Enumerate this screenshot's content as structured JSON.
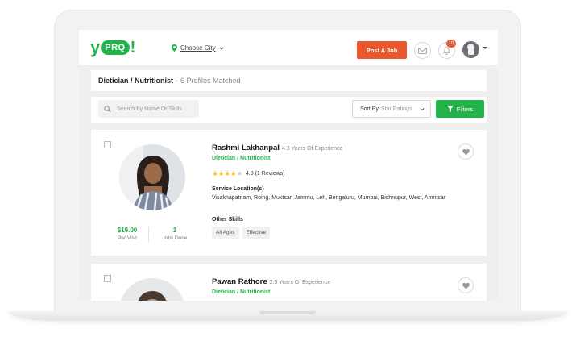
{
  "header": {
    "logo": {
      "y": "y",
      "prq": "PRQ",
      "ex": "!"
    },
    "city_label": "Choose City",
    "post_job_label": "Post A Job",
    "notifications_count": "10",
    "icons": [
      "location-pin-icon",
      "chevron-down-icon",
      "mail-icon",
      "bell-icon",
      "user-avatar",
      "caret-down-icon"
    ]
  },
  "results": {
    "query": "Dietician / Nutritionist",
    "separator": "-",
    "count_text": "6 Profiles Matched"
  },
  "filters": {
    "search_placeholder": "Search By Name Or Skills",
    "sort_label": "Sort By",
    "sort_value": "Star Ratings",
    "filters_label": "Filters"
  },
  "profiles": [
    {
      "name": "Rashmi Lakhanpal",
      "experience": "4.3 Years Of Experience",
      "role": "Dietician / Nutritionist",
      "rating_stars": 4,
      "rating_text": "4.0 (1 Reviews)",
      "service_location_label": "Service Location(s)",
      "service_locations": "Visakhapatnam, Roing, Muktsar, Jammu, Leh, Bengaluru, Mumbai, Bishnupur, West, Amritsar",
      "other_skills_label": "Other Skills",
      "skills": [
        "All Ages",
        "Effective"
      ],
      "price": "$19.00",
      "price_label": "Per Visit",
      "jobs_done": "1",
      "jobs_done_label": "Jobs Done"
    },
    {
      "name": "Pawan Rathore",
      "experience": "2.5 Years Of Experience",
      "role": "Dietician / Nutritionist"
    }
  ],
  "colors": {
    "brand_green": "#24b24b",
    "accent_orange": "#e8572e",
    "star": "#f5b92e"
  }
}
